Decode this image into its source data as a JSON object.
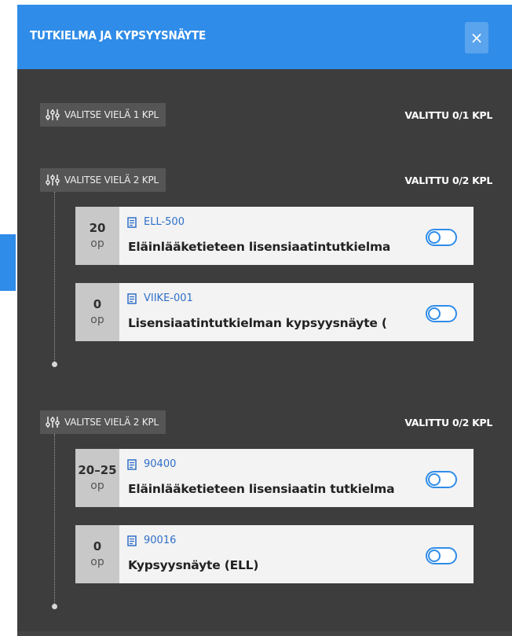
{
  "modal": {
    "title": "TUTKIELMA JA KYPSYYSNÄYTE",
    "close_label": "×"
  },
  "colors": {
    "accent": "#2f8ce8",
    "modal_bg": "#3d3d3d",
    "chip_bg": "#555555",
    "course_bg": "#f3f3f3",
    "credit_bg": "#c8c8c8",
    "code_text": "#2f6fc8"
  },
  "icons": {
    "rule": "sliders-icon",
    "course": "document-icon",
    "close": "close-icon"
  },
  "groups": [
    {
      "rule_label": "VALITSE VIELÄ 1 KPL",
      "selected_label": "VALITTU 0/1 KPL",
      "courses": []
    },
    {
      "rule_label": "VALITSE VIELÄ 2 KPL",
      "selected_label": "VALITTU 0/2 KPL",
      "courses": [
        {
          "credits": "20",
          "unit": "op",
          "code": "ELL-500",
          "name": "Eläinlääketieteen lisensiaatintutkielma",
          "selected": false
        },
        {
          "credits": "0",
          "unit": "op",
          "code": "VIIKE-001",
          "name": "Lisensiaatintutkielman kypsyysnäyte (",
          "selected": false
        }
      ]
    },
    {
      "rule_label": "VALITSE VIELÄ 2 KPL",
      "selected_label": "VALITTU 0/2 KPL",
      "courses": [
        {
          "credits": "20–25",
          "unit": "op",
          "code": "90400",
          "name": "Eläinlääketieteen lisensiaatin tutkielma",
          "selected": false
        },
        {
          "credits": "0",
          "unit": "op",
          "code": "90016",
          "name": "Kypsyysnäyte (ELL)",
          "selected": false
        }
      ]
    }
  ]
}
